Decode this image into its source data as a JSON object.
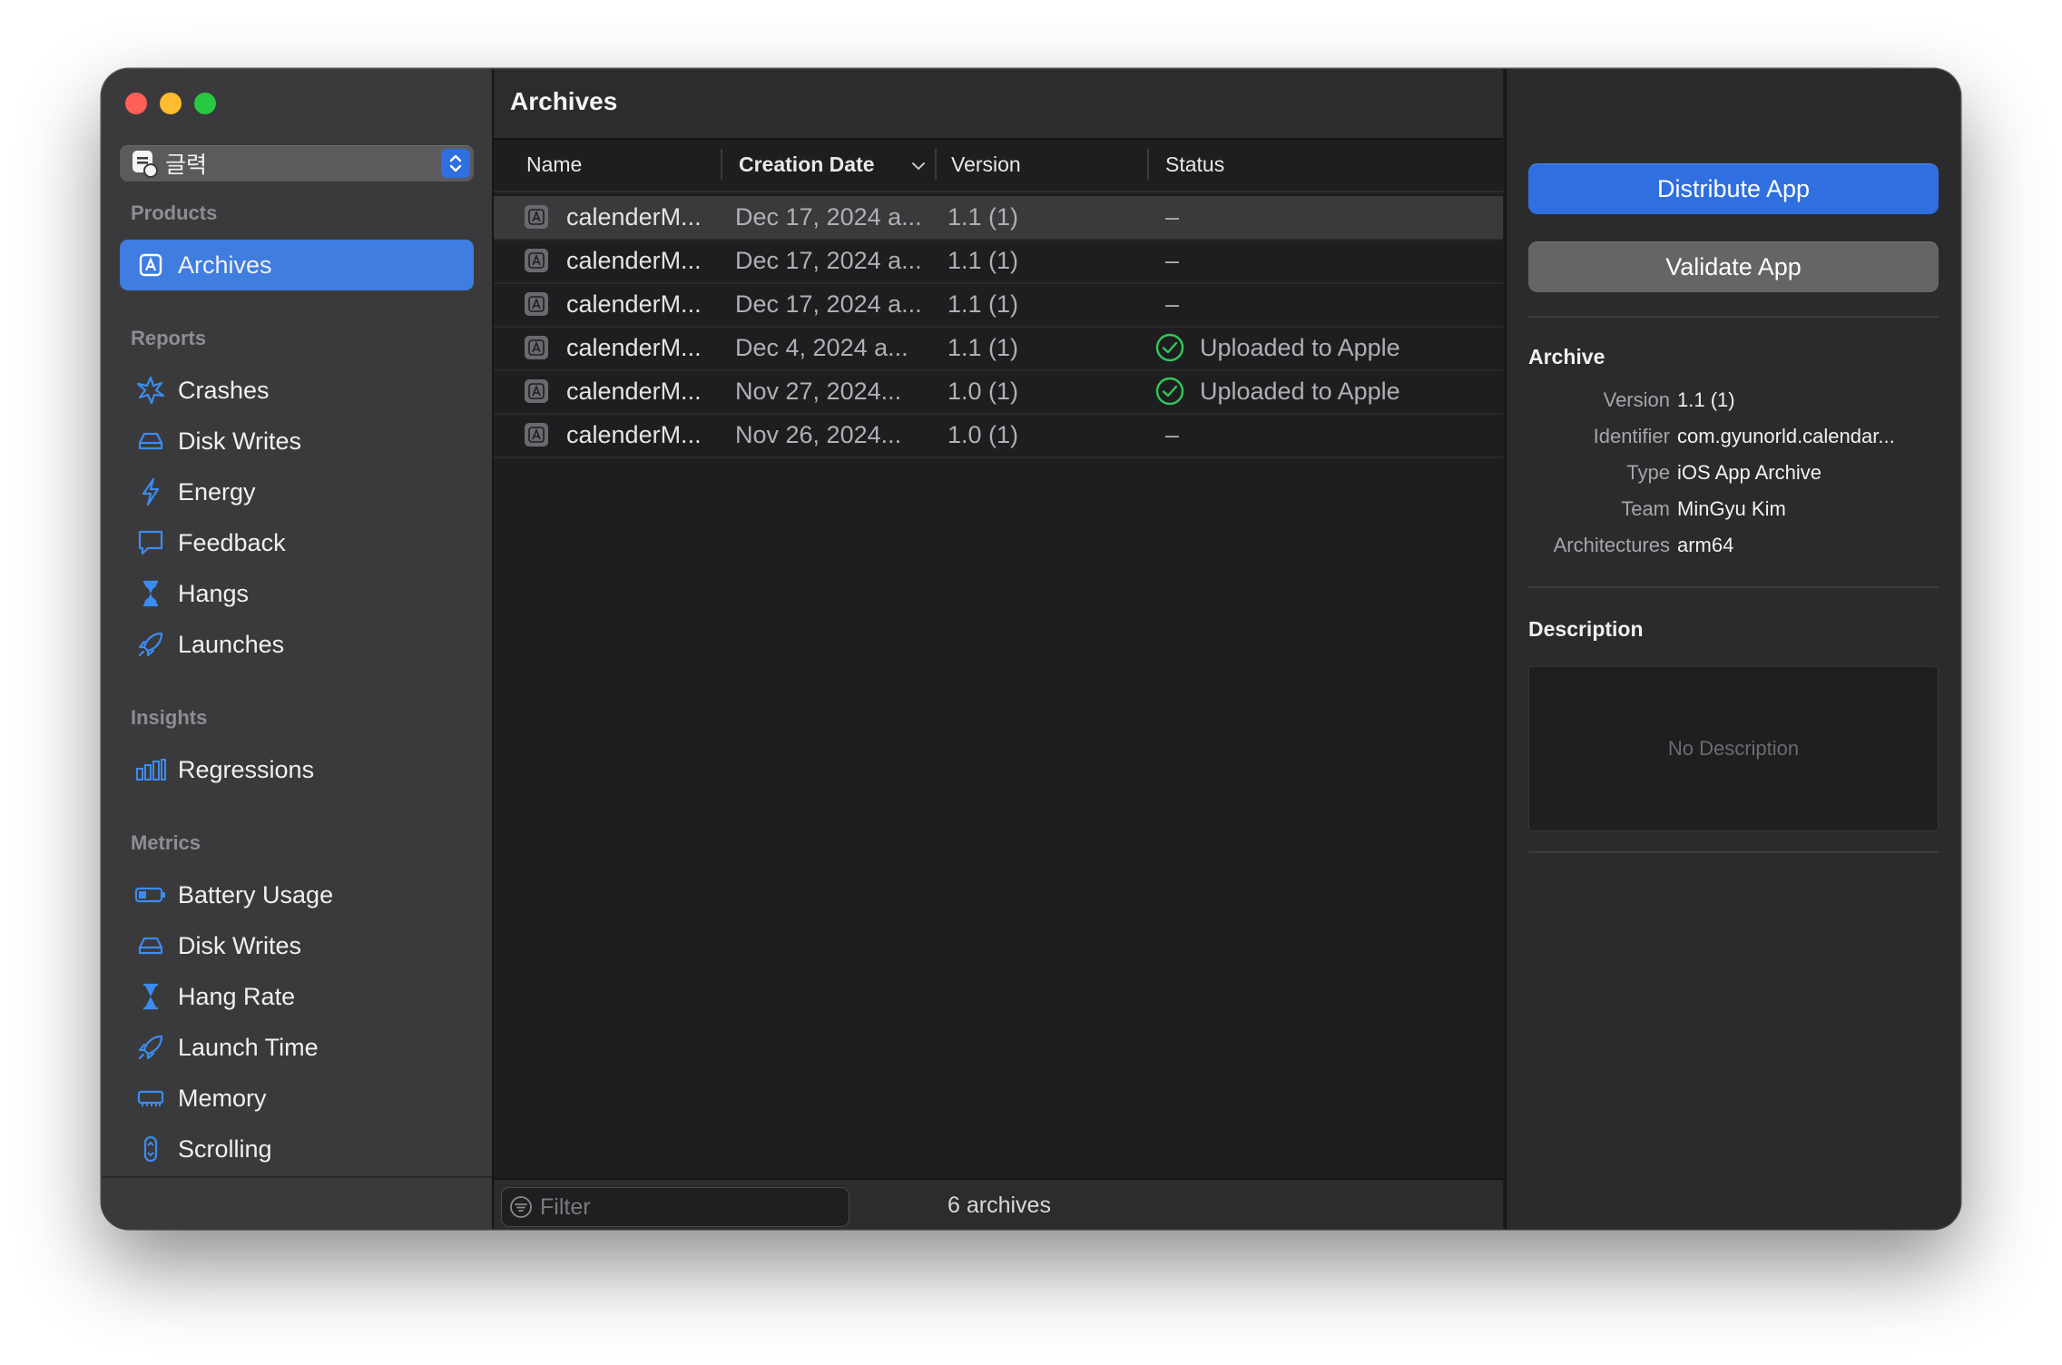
{
  "sidebar": {
    "scheme": {
      "label": "글력"
    },
    "sections": {
      "products": "Products",
      "reports": "Reports",
      "insights": "Insights",
      "metrics": "Metrics"
    },
    "products": [
      {
        "label": "Archives",
        "icon": "archive-icon",
        "selected": true
      }
    ],
    "reports": [
      {
        "label": "Crashes",
        "icon": "crash-burst-icon"
      },
      {
        "label": "Disk Writes",
        "icon": "disk-icon"
      },
      {
        "label": "Energy",
        "icon": "bolt-icon"
      },
      {
        "label": "Feedback",
        "icon": "speech-bubble-icon"
      },
      {
        "label": "Hangs",
        "icon": "hourglass-icon"
      },
      {
        "label": "Launches",
        "icon": "rocket-icon"
      }
    ],
    "insights": [
      {
        "label": "Regressions",
        "icon": "bar-chart-icon"
      }
    ],
    "metrics": [
      {
        "label": "Battery Usage",
        "icon": "battery-icon"
      },
      {
        "label": "Disk Writes",
        "icon": "disk-icon"
      },
      {
        "label": "Hang Rate",
        "icon": "hourglass-icon"
      },
      {
        "label": "Launch Time",
        "icon": "rocket-icon"
      },
      {
        "label": "Memory",
        "icon": "memory-chip-icon"
      },
      {
        "label": "Scrolling",
        "icon": "scroll-icon"
      }
    ]
  },
  "main": {
    "title": "Archives",
    "columns": {
      "name": "Name",
      "creation_date": "Creation Date",
      "version": "Version",
      "status": "Status"
    },
    "rows": [
      {
        "name": "calenderM...",
        "date": "Dec 17, 2024 a...",
        "version": "1.1 (1)",
        "status": "–",
        "uploaded": false,
        "selected": true
      },
      {
        "name": "calenderM...",
        "date": "Dec 17, 2024 a...",
        "version": "1.1 (1)",
        "status": "–",
        "uploaded": false
      },
      {
        "name": "calenderM...",
        "date": "Dec 17, 2024 a...",
        "version": "1.1 (1)",
        "status": "–",
        "uploaded": false
      },
      {
        "name": "calenderM...",
        "date": "Dec 4, 2024 a...",
        "version": "1.1 (1)",
        "status": "Uploaded to Apple",
        "uploaded": true
      },
      {
        "name": "calenderM...",
        "date": "Nov 27, 2024...",
        "version": "1.0 (1)",
        "status": "Uploaded to Apple",
        "uploaded": true
      },
      {
        "name": "calenderM...",
        "date": "Nov 26, 2024...",
        "version": "1.0 (1)",
        "status": "–",
        "uploaded": false
      }
    ],
    "filter_placeholder": "Filter",
    "count": "6 archives"
  },
  "inspector": {
    "distribute_label": "Distribute App",
    "validate_label": "Validate App",
    "archive_title": "Archive",
    "fields": [
      {
        "key": "Version",
        "value": "1.1 (1)"
      },
      {
        "key": "Identifier",
        "value": "com.gyunorld.calendar..."
      },
      {
        "key": "Type",
        "value": "iOS App Archive"
      },
      {
        "key": "Team",
        "value": "MinGyu Kim"
      },
      {
        "key": "Architectures",
        "value": "arm64"
      }
    ],
    "description_title": "Description",
    "description_empty": "No Description"
  },
  "colors": {
    "accent": "#3f7de0",
    "icon_blue": "#3b8cf0",
    "success_green": "#34c759",
    "close": "#fe5f57",
    "minimize": "#febc2e",
    "zoom": "#28c840"
  }
}
